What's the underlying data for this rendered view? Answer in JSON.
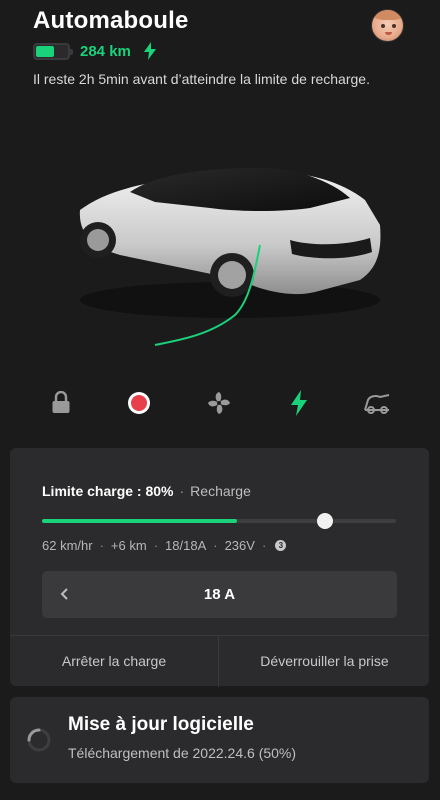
{
  "vehicle": {
    "name": "Automaboule",
    "range": "284 km",
    "battery_level": 0.55,
    "message": "Il reste 2h 5min avant d’atteindre la limite de recharge."
  },
  "controls": [
    {
      "icon": "lock-icon"
    },
    {
      "icon": "record-icon"
    },
    {
      "icon": "fan-icon"
    },
    {
      "icon": "charge-bolt-icon"
    },
    {
      "icon": "trunk-icon"
    }
  ],
  "charging": {
    "limit_label": "Limite charge : 80%",
    "status": "Recharge",
    "charge_progress": 0.55,
    "limit_percent": 80,
    "stats": [
      "62 km/hr",
      "+6 km",
      "18/18A",
      "236V"
    ],
    "info_badge": "3",
    "current": "18 A",
    "stop_label": "Arrêter la charge",
    "unlock_label": "Déverrouiller la prise"
  },
  "update": {
    "title": "Mise à jour logicielle",
    "subtitle": "Téléchargement de 2022.24.6 (50%)"
  },
  "colors": {
    "accent": "#19d27a",
    "record": "#e8404a",
    "background": "#1b1b1c",
    "card": "#2b2b2d"
  }
}
